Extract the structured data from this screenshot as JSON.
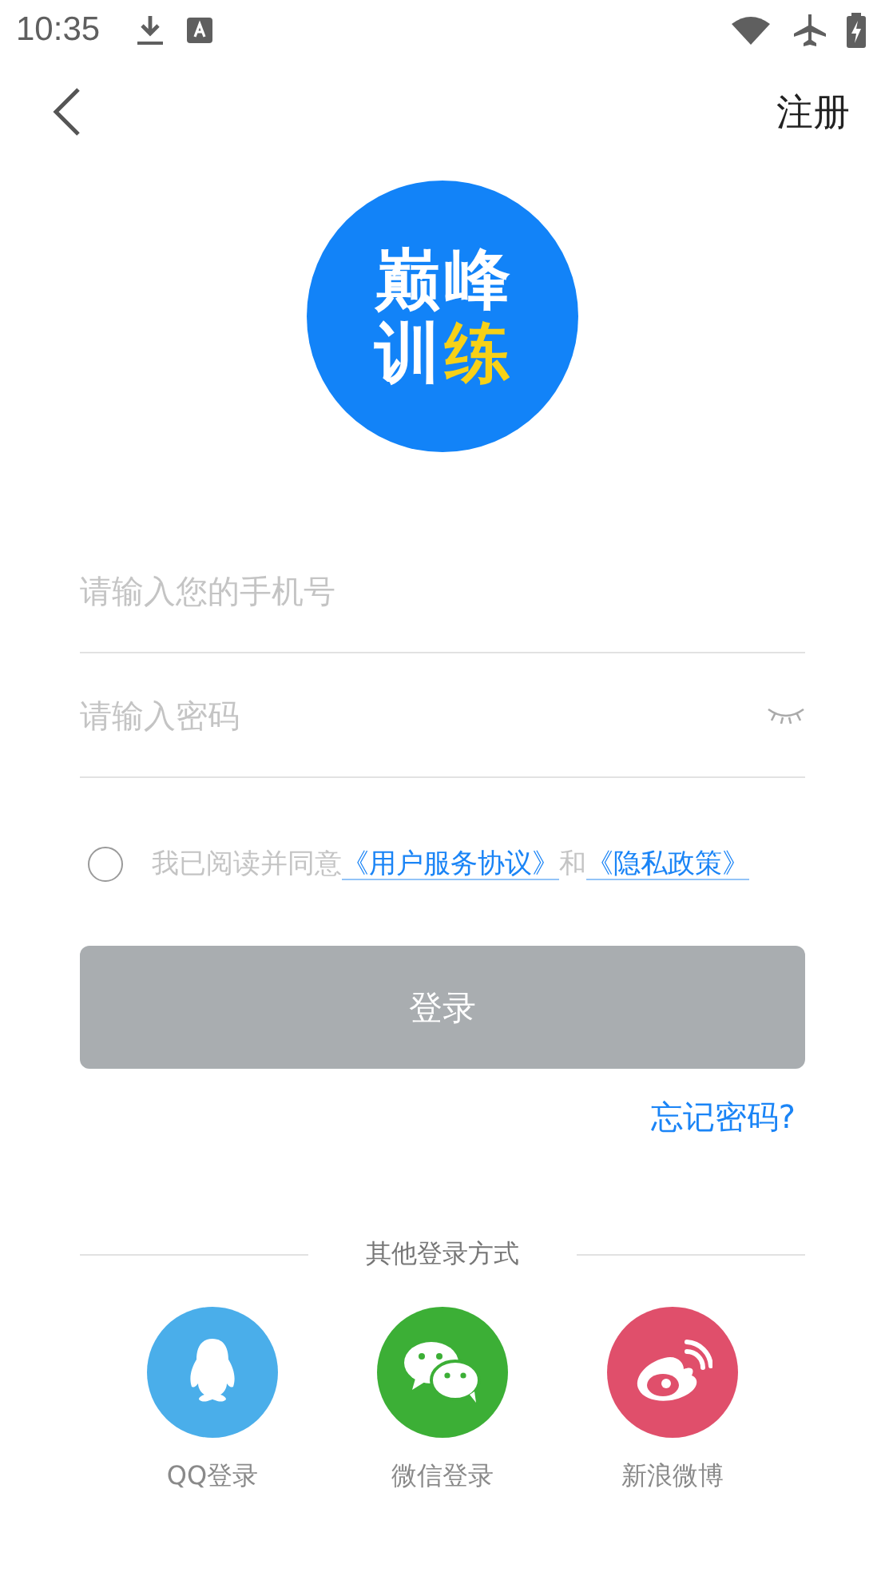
{
  "status_bar": {
    "time": "10:35"
  },
  "header": {
    "register": "注册"
  },
  "logo": {
    "chars": [
      {
        "text": "巅",
        "color": "#ffffff"
      },
      {
        "text": "峰",
        "color": "#ffffff"
      },
      {
        "text": "训",
        "color": "#ffffff"
      },
      {
        "text": "练",
        "color": "#f7d117"
      }
    ]
  },
  "phone_field": {
    "placeholder": "请输入您的手机号"
  },
  "password_field": {
    "placeholder": "请输入密码",
    "visible": false
  },
  "agreement": {
    "checked": false,
    "prefix": "我已阅读并同意",
    "terms_link": "《用户服务协议》",
    "joiner": "和",
    "privacy_link": "《隐私政策》"
  },
  "login_button": {
    "label": "登录",
    "disabled": true
  },
  "forgot_password": "忘记密码?",
  "other_logins": {
    "title": "其他登录方式",
    "providers": [
      {
        "kind": "qq",
        "label": "QQ登录",
        "color": "#4aaeea"
      },
      {
        "kind": "wechat",
        "label": "微信登录",
        "color": "#3caf36"
      },
      {
        "kind": "weibo",
        "label": "新浪微博",
        "color": "#e04f6b"
      }
    ]
  }
}
